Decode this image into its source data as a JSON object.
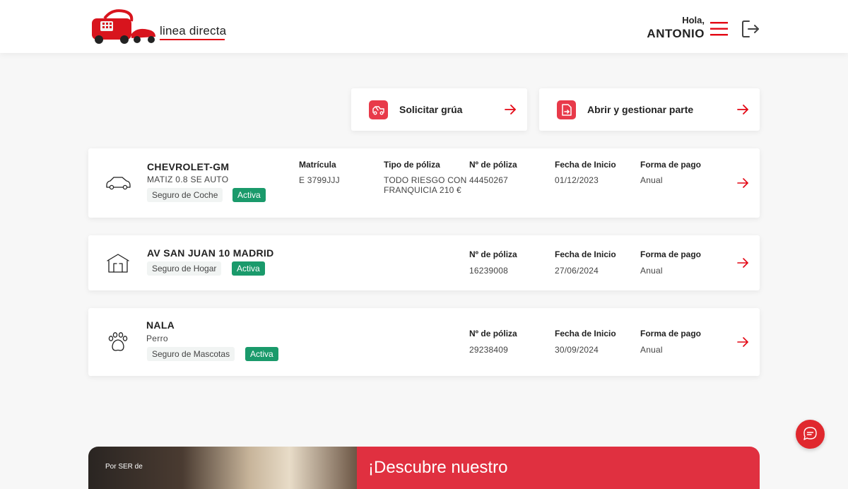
{
  "header": {
    "logo_text": "linea directa",
    "greeting": "Hola,",
    "user_name": "ANTONIO"
  },
  "actions": [
    {
      "label": "Solicitar grúa",
      "icon": "tow-truck-icon"
    },
    {
      "label": "Abrir y gestionar parte",
      "icon": "claim-document-icon"
    }
  ],
  "policies": [
    {
      "icon": "car-icon",
      "title": "CHEVROLET-GM",
      "subtitle": "MATIZ 0.8 SE AUTO",
      "type": "Seguro de Coche",
      "status": "Activa",
      "matricula_label": "Matrícula",
      "matricula": "E 3799JJJ",
      "tipo_label": "Tipo de póliza",
      "tipo": "TODO RIESGO CON FRANQUICIA 210 €",
      "num_label": "Nº de póliza",
      "num": "44450267",
      "fecha_label": "Fecha de Inicio",
      "fecha": "01/12/2023",
      "pago_label": "Forma de pago",
      "pago": "Anual"
    },
    {
      "icon": "house-icon",
      "title": "AV SAN JUAN 10 MADRID",
      "type": "Seguro de Hogar",
      "status": "Activa",
      "num_label": "Nº de póliza",
      "num": "16239008",
      "fecha_label": "Fecha de Inicio",
      "fecha": "27/06/2024",
      "pago_label": "Forma de pago",
      "pago": "Anual"
    },
    {
      "icon": "paw-icon",
      "title": "NALA",
      "subtitle": "Perro",
      "type": "Seguro de Mascotas",
      "status": "Activa",
      "num_label": "Nº de póliza",
      "num": "29238409",
      "fecha_label": "Fecha de Inicio",
      "fecha": "30/09/2024",
      "pago_label": "Forma de pago",
      "pago": "Anual"
    }
  ],
  "promo": {
    "image_caption": "Por SER de",
    "headline": "¡Descubre nuestro"
  },
  "colors": {
    "brand_red": "#e30613",
    "accent_red": "#e83a4a",
    "status_green": "#1a9a6b",
    "promo_red": "#e03040"
  }
}
